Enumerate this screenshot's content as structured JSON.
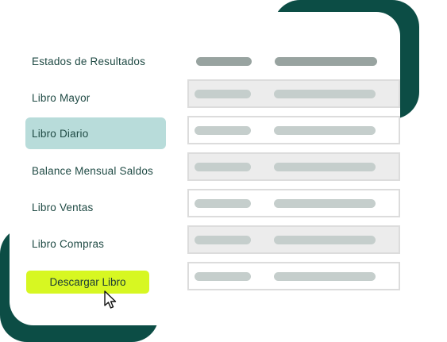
{
  "menu": {
    "items": [
      {
        "label": "Estados de Resultados"
      },
      {
        "label": "Libro Mayor"
      },
      {
        "label": "Libro Diario",
        "active": true
      },
      {
        "label": "Balance Mensual Saldos"
      },
      {
        "label": "Libro Ventas"
      },
      {
        "label": "Libro Compras"
      }
    ],
    "download_label": "Descargar Libro"
  },
  "colors": {
    "brand_dark": "#0c4d45",
    "accent": "#d7f722",
    "active_item": "#b8dcda",
    "text": "#1f4a44"
  },
  "icons": {
    "cursor": "arrow-cursor-icon"
  }
}
